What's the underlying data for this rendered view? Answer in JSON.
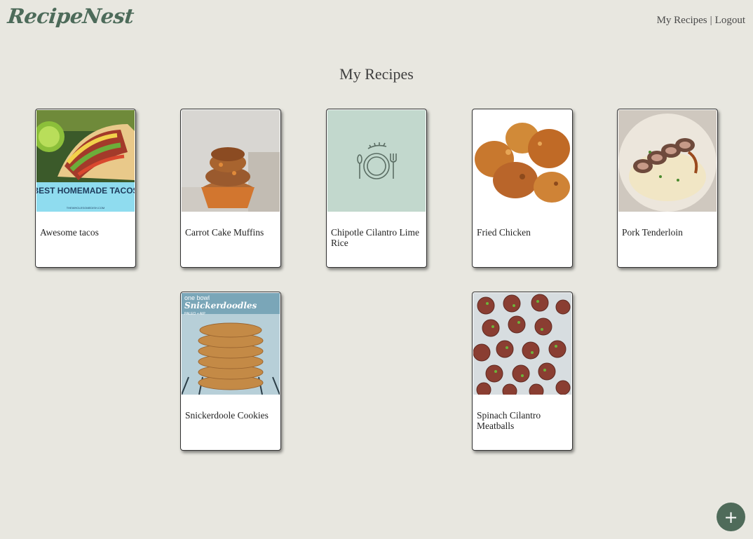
{
  "header": {
    "logo": "RecipeNest",
    "nav": {
      "my_recipes": "My Recipes",
      "separator": "|",
      "logout": "Logout"
    }
  },
  "main": {
    "title": "My Recipes",
    "recipes": [
      {
        "name": "Awesome tacos",
        "image_text": "BEST HOMEMADE TACOS",
        "image_subtext": "THEWHOLESOMEDISH.COM"
      },
      {
        "name": "Carrot Cake Muffins"
      },
      {
        "name": "Chipotle Cilantro Lime Rice",
        "image": "placeholder-plate-icon"
      },
      {
        "name": "Fried Chicken"
      },
      {
        "name": "Pork Tenderloin"
      },
      {
        "name": "Snickerdoole Cookies",
        "image_text_top": "one bowl",
        "image_text_mid": "Snickerdoodles",
        "image_text_small": "PALEO + AIP"
      },
      {
        "name": "Spinach Cilantro Meatballs"
      }
    ]
  },
  "fab": {
    "label": "+"
  },
  "colors": {
    "background": "#e8e7e0",
    "brand": "#4d6b5a",
    "placeholder_bg": "#c2d8cd"
  }
}
